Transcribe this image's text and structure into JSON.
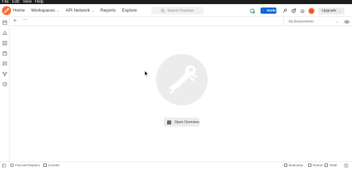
{
  "os_menu": {
    "items": [
      "File",
      "Edit",
      "View",
      "Help"
    ]
  },
  "header": {
    "nav": [
      {
        "label": "Home",
        "dropdown": false
      },
      {
        "label": "Workspaces",
        "dropdown": true
      },
      {
        "label": "API Network",
        "dropdown": true
      },
      {
        "label": "Reports",
        "dropdown": false
      },
      {
        "label": "Explore",
        "dropdown": false
      }
    ],
    "search_placeholder": "Search Postman",
    "invite_label": "Invite",
    "upgrade_label": "Upgrade"
  },
  "tabs": {
    "plus": "+",
    "more": "···",
    "environment": "No Environment"
  },
  "center": {
    "open_overview_label": "Open Overview"
  },
  "footer": {
    "find_replace": "Find and Replace",
    "console": "Console",
    "bootcamp": "Bootcamp",
    "runner": "Runner",
    "trash": "Trash"
  },
  "colors": {
    "brand_orange": "#ff6c37",
    "invite_blue": "#0265d2",
    "os_bar": "#1d1d1d",
    "hero_circle": "#ececec"
  },
  "icons": {
    "sidebar": [
      "collections-icon",
      "apis-icon",
      "environments-icon",
      "mock-servers-icon",
      "monitors-icon",
      "flows-icon",
      "history-icon"
    ],
    "header": [
      "sync-icon",
      "invite-icon",
      "satellite-icon",
      "settings-icon",
      "notifications-icon"
    ]
  }
}
